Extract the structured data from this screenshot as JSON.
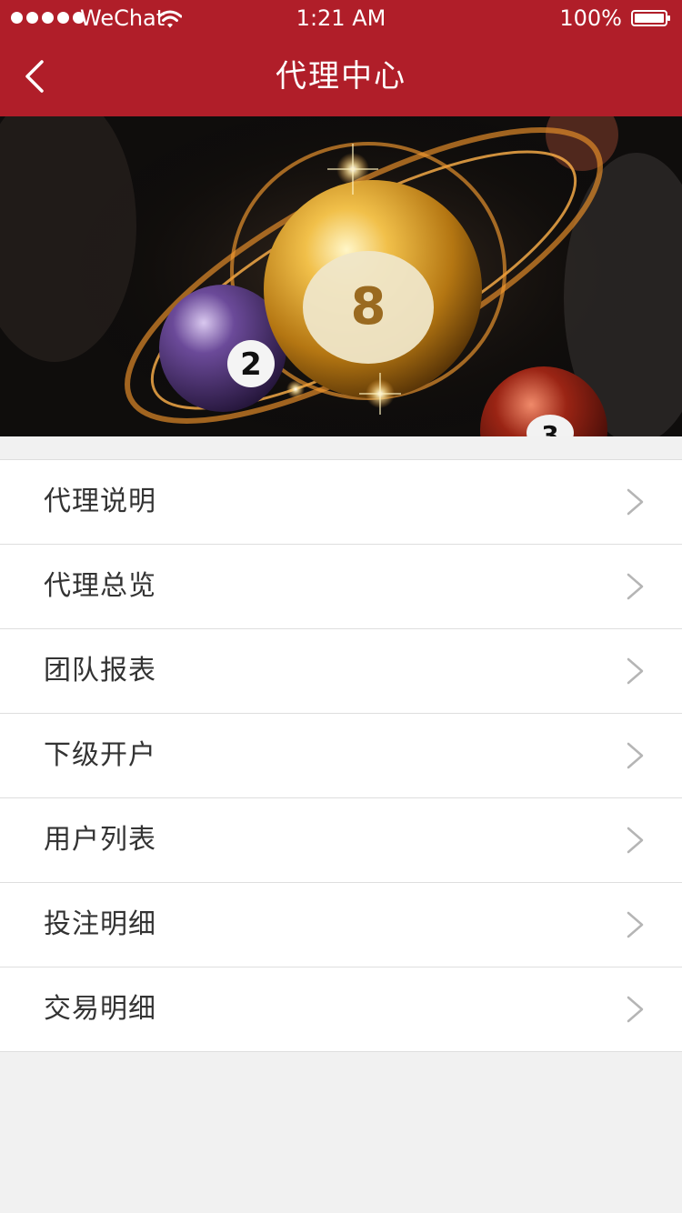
{
  "status_bar": {
    "carrier": "WeChat",
    "time": "1:21 AM",
    "battery": "100%",
    "signal_icon": "signal-dots-icon",
    "wifi_icon": "wifi-icon",
    "battery_icon": "battery-icon"
  },
  "nav": {
    "title": "代理中心",
    "back_icon": "chevron-left-icon"
  },
  "banner": {
    "image": "billiard-balls-banner",
    "ball_numbers": [
      "8",
      "2",
      "3"
    ]
  },
  "menu": {
    "items": [
      {
        "label": "代理说明"
      },
      {
        "label": "代理总览"
      },
      {
        "label": "团队报表"
      },
      {
        "label": "下级开户"
      },
      {
        "label": "用户列表"
      },
      {
        "label": "投注明细"
      },
      {
        "label": "交易明细"
      }
    ],
    "chevron_icon": "chevron-right-icon"
  },
  "colors": {
    "brand": "#b01e29",
    "background": "#f1f1f1",
    "text": "#333333",
    "chevron": "#b5b5b5"
  }
}
